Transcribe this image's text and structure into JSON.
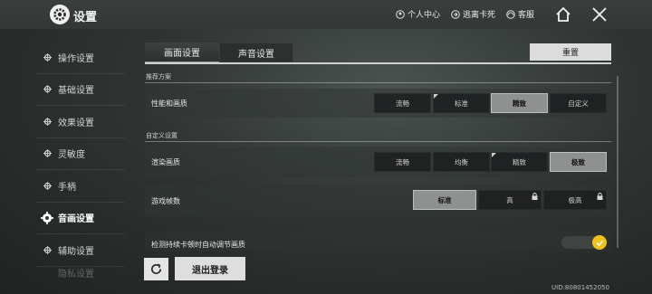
{
  "header": {
    "title": "设置",
    "links": [
      {
        "icon": "user-center-icon",
        "label": "个人中心"
      },
      {
        "icon": "escape-icon",
        "label": "逃离卡死"
      },
      {
        "icon": "support-icon",
        "label": "客服"
      }
    ],
    "home_icon": "home-icon",
    "close_icon": "close-icon"
  },
  "sidebar": {
    "items": [
      {
        "label": "操作设置"
      },
      {
        "label": "基础设置"
      },
      {
        "label": "效果设置"
      },
      {
        "label": "灵敏度"
      },
      {
        "label": "手柄"
      },
      {
        "label": "音画设置",
        "active": true
      },
      {
        "label": "辅助设置"
      },
      {
        "label": "隐私设置"
      }
    ]
  },
  "tabs": [
    {
      "label": "画面设置",
      "active": true
    },
    {
      "label": "声音设置",
      "active": false
    }
  ],
  "reset_label": "重置",
  "sections": {
    "recommended": "推荐方案",
    "custom": "自定义设置"
  },
  "rows": {
    "performance": {
      "label": "性能和画质",
      "options": [
        "流畅",
        "标准",
        "精致",
        "自定义"
      ],
      "selected": "精致"
    },
    "render": {
      "label": "渲染画质",
      "options": [
        "流畅",
        "均衡",
        "精致",
        "极致"
      ],
      "selected": "极致"
    },
    "framerate": {
      "label": "游戏帧数",
      "options": [
        "标准",
        "高",
        "极高"
      ],
      "selected": "标准",
      "locked": [
        "高",
        "极高"
      ]
    },
    "auto_adjust": {
      "label": "检测持续卡顿时自动调节画质",
      "enabled": true
    }
  },
  "footer": {
    "refresh_icon": "refresh-icon",
    "logout_label": "退出登录",
    "uid": "UID:80801452050"
  },
  "colors": {
    "accent_toggle": "#f2c21c",
    "selected_option": "#8e918f"
  }
}
